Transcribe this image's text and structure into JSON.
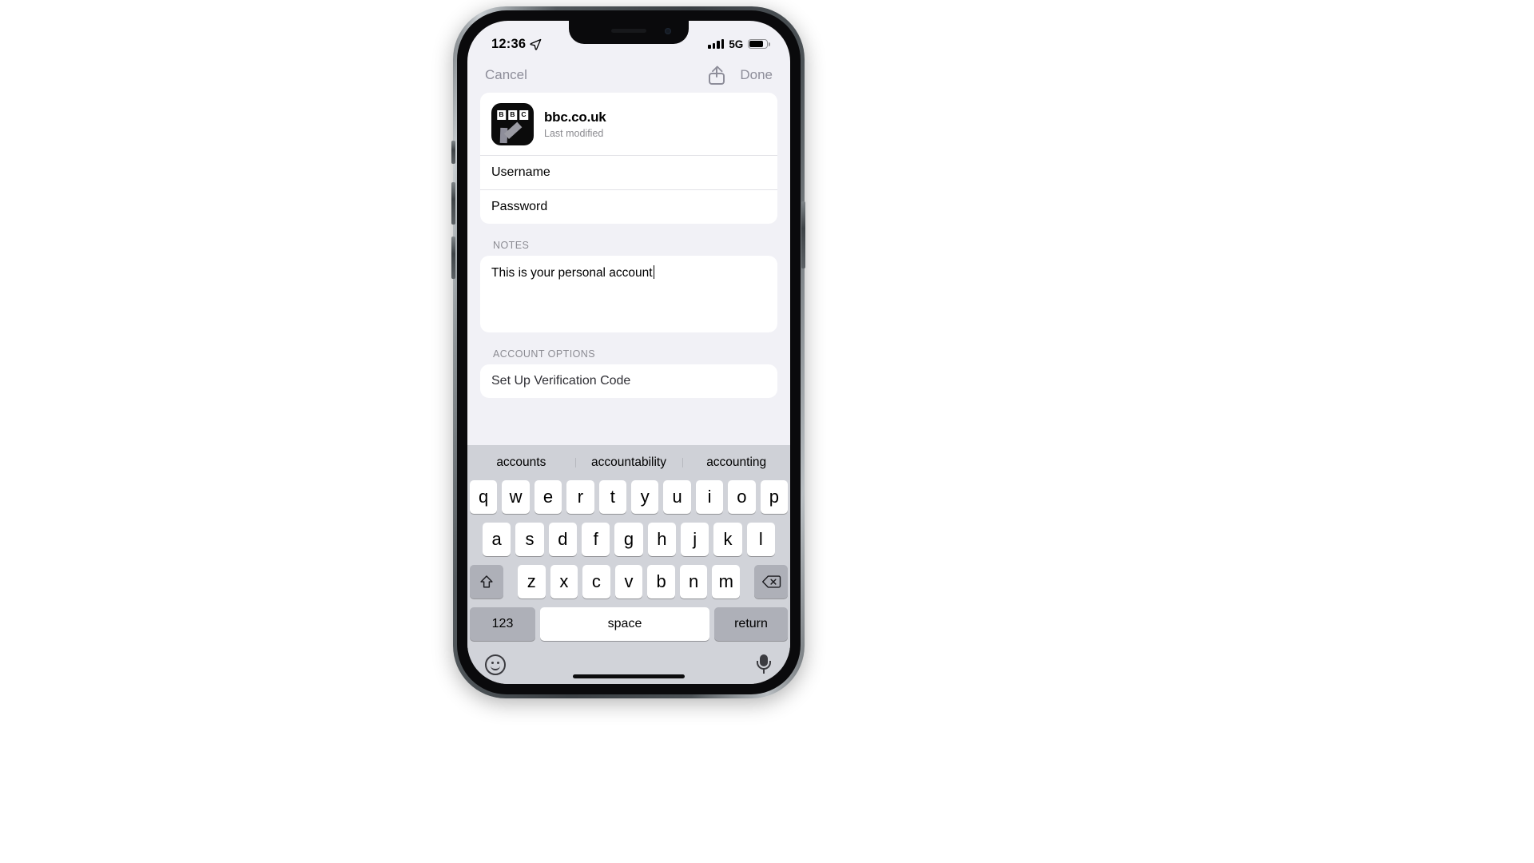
{
  "status_bar": {
    "time": "12:36",
    "location_icon": "location-arrow-icon",
    "signal_icon": "cellular-bars-icon",
    "network": "5G",
    "battery_icon": "battery-icon"
  },
  "nav_bar": {
    "cancel_label": "Cancel",
    "share_icon": "share-icon",
    "done_label": "Done"
  },
  "credential": {
    "icon": "bbc-favicon",
    "icon_letters": [
      "B",
      "B",
      "C"
    ],
    "site": "bbc.co.uk",
    "subtitle": "Last modified",
    "username_label": "Username",
    "password_label": "Password"
  },
  "notes": {
    "section_label": "NOTES",
    "text": "This is your personal account"
  },
  "account_options": {
    "section_label": "ACCOUNT OPTIONS",
    "first_row": "Set Up Verification Code"
  },
  "keyboard": {
    "suggestions": [
      "accounts",
      "accountability",
      "accounting"
    ],
    "row1": [
      "q",
      "w",
      "e",
      "r",
      "t",
      "y",
      "u",
      "i",
      "o",
      "p"
    ],
    "row2": [
      "a",
      "s",
      "d",
      "f",
      "g",
      "h",
      "j",
      "k",
      "l"
    ],
    "row3": [
      "z",
      "x",
      "c",
      "v",
      "b",
      "n",
      "m"
    ],
    "shift_icon": "shift-icon",
    "delete_icon": "delete-backspace-icon",
    "numbers_label": "123",
    "space_label": "space",
    "return_label": "return",
    "emoji_icon": "emoji-smiley-icon",
    "dictation_icon": "microphone-icon"
  },
  "colors": {
    "screen_bg": "#f1f1f6",
    "card_bg": "#ffffff",
    "keyboard_bg": "#d1d3d9",
    "key_bg": "#ffffff",
    "modifier_key_bg": "#aeb0b8",
    "muted_text": "#8e8e9a"
  }
}
